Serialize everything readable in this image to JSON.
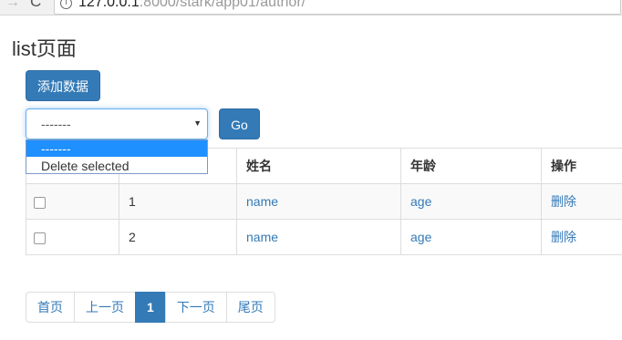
{
  "browser": {
    "forward_icon": "→",
    "reload_icon": "C",
    "url_host": "127.0.0.1",
    "url_rest": ":8000/stark/app01/author/"
  },
  "page": {
    "title": "list页面"
  },
  "toolbar": {
    "add_label": "添加数据",
    "go_label": "Go"
  },
  "action_select": {
    "value": "-------",
    "options": [
      "-------",
      "Delete selected"
    ]
  },
  "table": {
    "headers": [
      "",
      "",
      "姓名",
      "年龄",
      "操作"
    ],
    "rows": [
      {
        "id": "1",
        "name": "name",
        "age": "age",
        "action": "删除"
      },
      {
        "id": "2",
        "name": "name",
        "age": "age",
        "action": "删除"
      }
    ]
  },
  "pagination": {
    "first": "首页",
    "prev": "上一页",
    "current": "1",
    "next": "下一页",
    "last": "尾页"
  },
  "colors": {
    "primary": "#337ab7",
    "dropdown_highlight": "#1e90ff"
  }
}
